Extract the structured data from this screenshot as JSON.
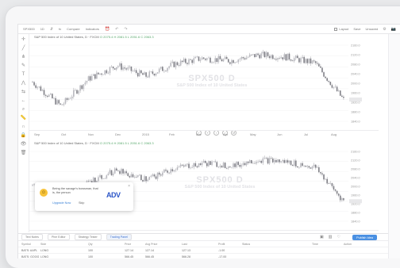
{
  "toolbar": {
    "symbol": "SPX500",
    "items": [
      "1D",
      "⇵",
      "fx",
      "Compare",
      "Indicators"
    ],
    "layout_label": "Layout",
    "save_label": "Save",
    "saved_label": "Unsaved"
  },
  "panes": [
    {
      "title": "S&P 500 Index of 10 United States, D",
      "brand": "FXCM",
      "ohlc": "O 2075.4 H 2081.5 L 2051.6 C 2063.3",
      "watermark_ticker": "SPX500 D",
      "watermark_sub": "S&P 500 Index of 10 United States"
    },
    {
      "title": "S&P 500 Index of 10 United States, D",
      "brand": "FXCM",
      "ohlc": "O 2075.4 H 2081.5 L 2051.6 C 2063.3",
      "watermark_ticker": "SPX500 D",
      "watermark_sub": "S&P 500 Index of 10 United States"
    }
  ],
  "time_axis": [
    "Sep",
    "Oct",
    "Nov",
    "Dec",
    "2015",
    "Feb",
    "Mar",
    "Apr",
    "May",
    "Jun",
    "Jul",
    "Aug"
  ],
  "intervals": [
    "1D",
    "5D",
    "1M",
    "3M",
    "6M",
    "YTD",
    "1Y",
    "5Y",
    "All"
  ],
  "price_labels": [
    "2160.0",
    "2120.0",
    "2080.0",
    "2040.0",
    "2000.0",
    "1960.0",
    "1920.0",
    "1880.0",
    "1840.0"
  ],
  "bottom_tabs": [
    "Text Notes",
    "Pine Editor",
    "Strategy Tester",
    "Trading Panel"
  ],
  "publish_label": "Publish Idea",
  "table_headers": [
    "Symbol",
    "Side",
    "Qty",
    "Price",
    "Avg Price",
    "Last",
    "Profit",
    "Status",
    "Time",
    "Action"
  ],
  "table_rows": [
    [
      "BATS: AAPL",
      "LONG",
      "100",
      "127.14",
      "127.14",
      "127.13",
      "-1.00",
      "",
      "",
      ""
    ],
    [
      "BATS: GOOG",
      "LONG",
      "100",
      "566.45",
      "566.45",
      "566.28",
      "-17.00",
      "",
      "",
      ""
    ]
  ],
  "popup": {
    "message": "Being the savage's bowsman, that is, the person",
    "upgrade_label": "Upgrade Now",
    "skip_label": "Skip",
    "brand": "ADV",
    "close": "×"
  },
  "colors": {
    "candle_up": "#b9b9bf",
    "candle_down": "#7f7f86",
    "accent": "#4a90e2",
    "ohlc_text": "#58a86c"
  },
  "chart_data": {
    "type": "line",
    "title": "S&P 500 Index of 10 United States, D",
    "x": [
      "Sep",
      "Oct",
      "Nov",
      "Dec",
      "2015",
      "Feb",
      "Mar",
      "Apr",
      "May",
      "Jun",
      "Jul",
      "Aug"
    ],
    "series": [
      {
        "name": "SPX500",
        "values": [
          2005,
          1905,
          2020,
          2075,
          2030,
          2080,
          2105,
          2095,
          2120,
          2110,
          2085,
          1930
        ]
      }
    ],
    "ylim": [
      1840,
      2160
    ]
  }
}
